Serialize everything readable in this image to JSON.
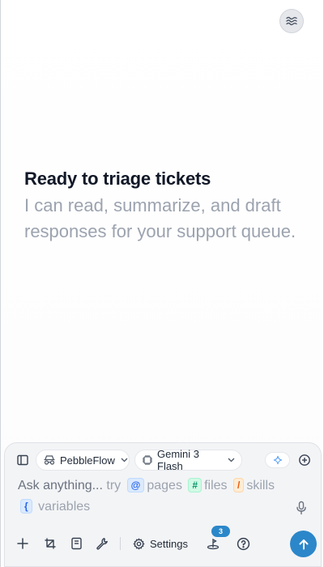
{
  "header": {
    "menu_icon": "waves-icon"
  },
  "hero": {
    "title": "Ready to triage tickets",
    "subtitle": "I can read, summarize, and draft responses for your support queue."
  },
  "composer": {
    "sidebar_toggle_icon": "sidebar-icon",
    "agent_selector": {
      "icon": "incognito-icon",
      "label": "PebbleFlow"
    },
    "model_selector": {
      "icon": "chip-icon",
      "label": "Gemini 3 Flash"
    },
    "sparkle_icon": "sparkle-icon",
    "new_chat_icon": "plus-circle-icon",
    "input": {
      "lead": "Ask anything...",
      "try_word": "try",
      "pages_symbol": "@",
      "pages_label": "pages",
      "files_symbol": "#",
      "files_label": "files",
      "skills_symbol": "/",
      "skills_label": "skills",
      "variables_symbol": "{",
      "variables_label": "variables"
    },
    "mic_icon": "microphone-icon",
    "toolbar": {
      "add_icon": "plus-icon",
      "crop_icon": "crop-icon",
      "notes_icon": "notebook-icon",
      "tools_icon": "wrench-icon",
      "settings_label": "Settings",
      "tasks_badge": "3",
      "help_icon": "help-icon",
      "send_icon": "arrow-up-icon"
    },
    "colors": {
      "accent": "#2b87c9",
      "chip_pages": "#2563eb",
      "chip_files": "#059669",
      "chip_skills": "#ea580c"
    }
  }
}
